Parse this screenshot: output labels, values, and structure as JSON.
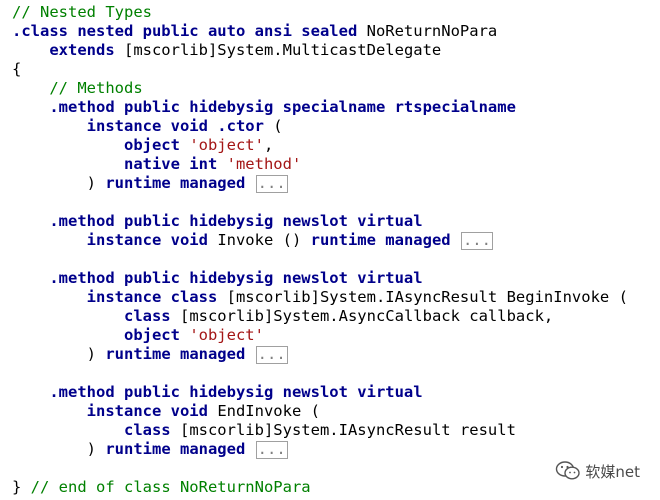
{
  "code_lines": [
    [
      {
        "t": "// Nested Types",
        "c": "cm"
      }
    ],
    [
      {
        "t": ".class nested public auto ansi sealed ",
        "c": "kw"
      },
      {
        "t": "NoReturnNoPara",
        "c": "pl"
      }
    ],
    [
      {
        "t": "    ",
        "c": "pl"
      },
      {
        "t": "extends ",
        "c": "kw"
      },
      {
        "t": "[mscorlib]System.MulticastDelegate",
        "c": "pl"
      }
    ],
    [
      {
        "t": "{",
        "c": "pl"
      }
    ],
    [
      {
        "t": "    ",
        "c": "pl"
      },
      {
        "t": "// Methods",
        "c": "cm"
      }
    ],
    [
      {
        "t": "    ",
        "c": "pl"
      },
      {
        "t": ".method public hidebysig specialname rtspecialname",
        "c": "kw"
      }
    ],
    [
      {
        "t": "        ",
        "c": "pl"
      },
      {
        "t": "instance void .ctor ",
        "c": "kw"
      },
      {
        "t": "(",
        "c": "pl"
      }
    ],
    [
      {
        "t": "            ",
        "c": "pl"
      },
      {
        "t": "object ",
        "c": "kw"
      },
      {
        "t": "'object'",
        "c": "st"
      },
      {
        "t": ",",
        "c": "pl"
      }
    ],
    [
      {
        "t": "            ",
        "c": "pl"
      },
      {
        "t": "native int ",
        "c": "kw"
      },
      {
        "t": "'method'",
        "c": "st"
      }
    ],
    [
      {
        "t": "        ",
        "c": "pl"
      },
      {
        "t": ") ",
        "c": "pl"
      },
      {
        "t": "runtime managed",
        "c": "kw"
      },
      {
        "t": " ",
        "c": "pl"
      },
      {
        "t": "...",
        "c": "fold"
      }
    ],
    [
      {
        "t": "",
        "c": "pl"
      }
    ],
    [
      {
        "t": "    ",
        "c": "pl"
      },
      {
        "t": ".method public hidebysig newslot virtual",
        "c": "kw"
      }
    ],
    [
      {
        "t": "        ",
        "c": "pl"
      },
      {
        "t": "instance void ",
        "c": "kw"
      },
      {
        "t": "Invoke () ",
        "c": "pl"
      },
      {
        "t": "runtime managed",
        "c": "kw"
      },
      {
        "t": " ",
        "c": "pl"
      },
      {
        "t": "...",
        "c": "fold"
      }
    ],
    [
      {
        "t": "",
        "c": "pl"
      }
    ],
    [
      {
        "t": "    ",
        "c": "pl"
      },
      {
        "t": ".method public hidebysig newslot virtual",
        "c": "kw"
      }
    ],
    [
      {
        "t": "        ",
        "c": "pl"
      },
      {
        "t": "instance class ",
        "c": "kw"
      },
      {
        "t": "[mscorlib]System.IAsyncResult BeginInvoke (",
        "c": "pl"
      }
    ],
    [
      {
        "t": "            ",
        "c": "pl"
      },
      {
        "t": "class ",
        "c": "kw"
      },
      {
        "t": "[mscorlib]System.AsyncCallback callback,",
        "c": "pl"
      }
    ],
    [
      {
        "t": "            ",
        "c": "pl"
      },
      {
        "t": "object ",
        "c": "kw"
      },
      {
        "t": "'object'",
        "c": "st"
      }
    ],
    [
      {
        "t": "        ",
        "c": "pl"
      },
      {
        "t": ") ",
        "c": "pl"
      },
      {
        "t": "runtime managed",
        "c": "kw"
      },
      {
        "t": " ",
        "c": "pl"
      },
      {
        "t": "...",
        "c": "fold"
      }
    ],
    [
      {
        "t": "",
        "c": "pl"
      }
    ],
    [
      {
        "t": "    ",
        "c": "pl"
      },
      {
        "t": ".method public hidebysig newslot virtual",
        "c": "kw"
      }
    ],
    [
      {
        "t": "        ",
        "c": "pl"
      },
      {
        "t": "instance void ",
        "c": "kw"
      },
      {
        "t": "EndInvoke (",
        "c": "pl"
      }
    ],
    [
      {
        "t": "            ",
        "c": "pl"
      },
      {
        "t": "class ",
        "c": "kw"
      },
      {
        "t": "[mscorlib]System.IAsyncResult result",
        "c": "pl"
      }
    ],
    [
      {
        "t": "        ",
        "c": "pl"
      },
      {
        "t": ") ",
        "c": "pl"
      },
      {
        "t": "runtime managed",
        "c": "kw"
      },
      {
        "t": " ",
        "c": "pl"
      },
      {
        "t": "...",
        "c": "fold"
      }
    ],
    [
      {
        "t": "",
        "c": "pl"
      }
    ],
    [
      {
        "t": "} ",
        "c": "pl"
      },
      {
        "t": "// end of class NoReturnNoPara",
        "c": "cm"
      }
    ]
  ],
  "colors": {
    "keyword": "#00008b",
    "comment": "#008000",
    "string": "#a31515",
    "plain": "#000000",
    "fold_border": "#a0a0a0"
  },
  "watermark": {
    "text": "软媒net",
    "icon": "wechat-icon"
  }
}
